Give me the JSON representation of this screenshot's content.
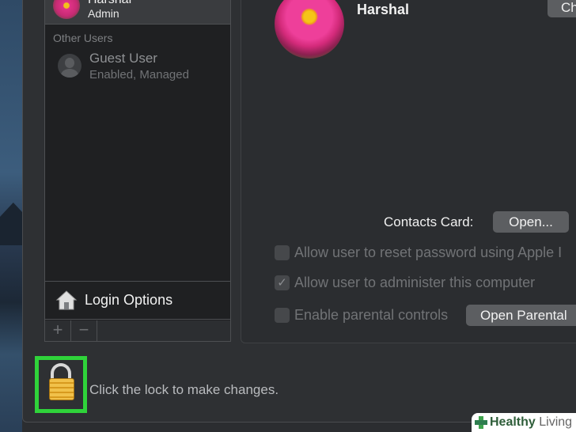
{
  "current_user": {
    "name": "Harshal",
    "role": "Admin"
  },
  "sidebar": {
    "section_label": "Other Users",
    "guest": {
      "name": "Guest User",
      "status": "Enabled, Managed"
    },
    "login_options_label": "Login Options",
    "add_label": "+",
    "remove_label": "−"
  },
  "main": {
    "user_name": "Harshal",
    "change_label": "Ch",
    "contacts_label": "Contacts Card:",
    "open_label": "Open...",
    "options": [
      {
        "label": "Allow user to reset password using Apple I",
        "checked": false
      },
      {
        "label": "Allow user to administer this computer",
        "checked": true
      },
      {
        "label": "Enable parental controls",
        "checked": false
      }
    ],
    "parental_button_label": "Open Parental"
  },
  "lock": {
    "message": "Click the lock to make changes.",
    "highlight_color": "#2fd33a"
  },
  "watermark": {
    "brand_bold": "Healthy",
    "brand_light": "Living"
  },
  "icons": {
    "lock": "lock-icon",
    "house": "house-icon",
    "guest": "person-silhouette-icon",
    "check": "checkmark-icon"
  }
}
